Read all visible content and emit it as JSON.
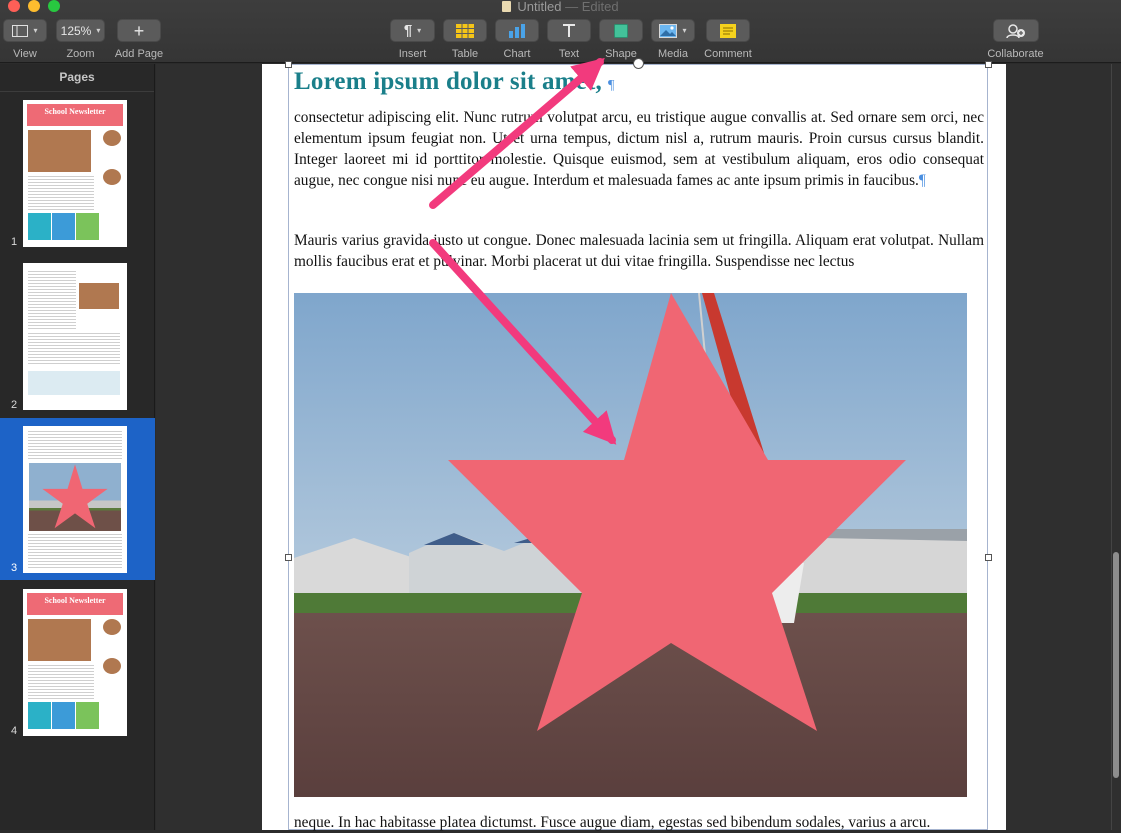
{
  "window": {
    "title": "Untitled",
    "status": "— Edited"
  },
  "toolbar": {
    "view_label": "View",
    "zoom_value": "125%",
    "zoom_label": "Zoom",
    "add_page_label": "Add Page",
    "insert_label": "Insert",
    "table_label": "Table",
    "chart_label": "Chart",
    "text_label": "Text",
    "shape_label": "Shape",
    "media_label": "Media",
    "comment_label": "Comment",
    "collaborate_label": "Collaborate"
  },
  "sidebar": {
    "title": "Pages",
    "pages": [
      {
        "number": "1",
        "banner": "School Newsletter"
      },
      {
        "number": "2"
      },
      {
        "number": "3"
      },
      {
        "number": "4",
        "banner": "School Newsletter"
      }
    ],
    "selected_page": 3
  },
  "document": {
    "heading": "Lorem ipsum dolor sit amet,",
    "para1": "consectetur adipiscing elit. Nunc rutrum volutpat arcu, eu tristique augue convallis at. Sed ornare sem orci, nec elementum ipsum feugiat non. Ut et urna tempus, dictum nisl a, rutrum mauris. Proin cursus cursus blandit. Integer laoreet mi id porttitor molestie. Quisque euismod, sem at vestibulum aliquam, eros odio consequat augue, nec congue nisi nunc eu augue. Interdum et malesuada fames ac ante ipsum primis in faucibus.",
    "para2": "Mauris varius gravida justo ut congue. Donec malesuada lacinia sem ut fringilla. Aliquam erat volutpat. Nullam mollis faucibus erat et pulvinar. Morbi placerat ut dui vitae fringilla. Suspendisse nec lectus",
    "para3": "neque. In hac habitasse platea dictumst. Fusce augue diam, egestas sed bibendum sodales, varius a arcu."
  },
  "colors": {
    "accent_blue": "#1d63c7",
    "heading_teal": "#1a7f8a",
    "star_pink": "#f06673",
    "arrow_pink": "#f23a7d",
    "shape_green": "#43c29a",
    "comment_yellow": "#f5d21d"
  },
  "icons": {
    "view": "sidebar-view-icon",
    "add_page": "plus-icon",
    "insert": "pilcrow-icon",
    "table": "table-icon",
    "chart": "bar-chart-icon",
    "text": "text-t-icon",
    "shape": "square-shape-icon",
    "media": "photo-icon",
    "comment": "comment-note-icon",
    "collaborate": "person-add-icon"
  }
}
